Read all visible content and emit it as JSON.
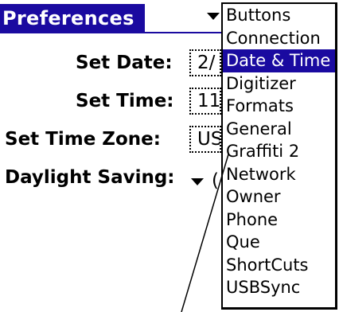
{
  "header": {
    "title": "Preferences"
  },
  "form": {
    "set_date": {
      "label": "Set Date:",
      "value": "2/"
    },
    "set_time": {
      "label": "Set Time:",
      "value": "11"
    },
    "set_time_zone": {
      "label": "Set Time Zone:",
      "value": "US"
    },
    "daylight_saving": {
      "label": "Daylight Saving:",
      "value": "("
    }
  },
  "category_menu": {
    "selected": "Date & Time",
    "items": [
      {
        "label": "Buttons"
      },
      {
        "label": "Connection"
      },
      {
        "label": "Date & Time"
      },
      {
        "label": "Digitizer"
      },
      {
        "label": "Formats"
      },
      {
        "label": "General"
      },
      {
        "label": "Graffiti 2"
      },
      {
        "label": "Network"
      },
      {
        "label": "Owner"
      },
      {
        "label": "Phone"
      },
      {
        "label": "Que"
      },
      {
        "label": "ShortCuts"
      },
      {
        "label": "USBSync"
      }
    ]
  },
  "colors": {
    "accent": "#1a0aa0",
    "background": "#ffffff",
    "text": "#000000"
  }
}
